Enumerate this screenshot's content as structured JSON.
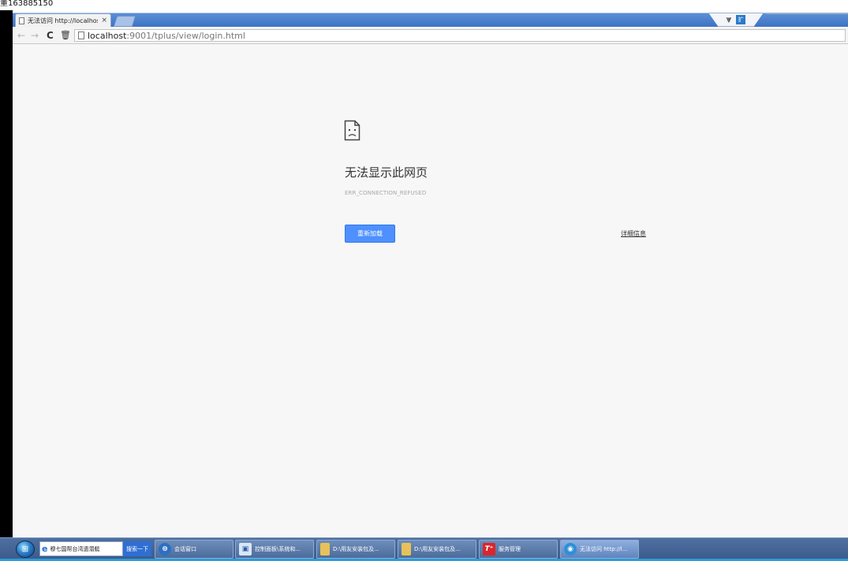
{
  "top_text": "董163885150",
  "tab": {
    "title": "无法访问 http://localhos",
    "close": "×"
  },
  "window": {
    "v_icon": "⩔",
    "expand_icon": "扩"
  },
  "toolbar": {
    "back": "←",
    "forward": "→",
    "reload": "C",
    "trash": "🗑",
    "url_host": "localhost",
    "url_rest": ":9001/tplus/view/login.html"
  },
  "error_page": {
    "title": "无法显示此网页",
    "code": "ERR_CONNECTION_REFUSED",
    "reload_button": "重新加载",
    "details_link": "详细信息"
  },
  "taskbar": {
    "start": "⊞",
    "ie_search_text": "穆七国帮台湾遗潜艇",
    "search_button": "搜索一下",
    "tasks": [
      {
        "label": "会话窗口",
        "icon": "chat-icon"
      },
      {
        "label": "控制面板\\系统和...",
        "icon": "control-panel-icon"
      },
      {
        "label": "D:\\用友安装包及...",
        "icon": "folder-icon"
      },
      {
        "label": "D:\\用友安装包及...",
        "icon": "folder-icon"
      },
      {
        "label": "服务管理",
        "icon": "tplus-icon"
      },
      {
        "label": "无法访问 http://l...",
        "icon": "chrome-icon"
      }
    ]
  }
}
